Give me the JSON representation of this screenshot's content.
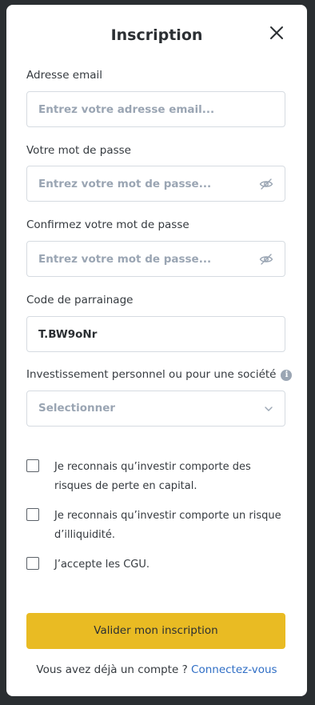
{
  "modal": {
    "title": "Inscription",
    "close_icon": "close-icon"
  },
  "email": {
    "label": "Adresse email",
    "placeholder": "Entrez votre adresse email..."
  },
  "password": {
    "label": "Votre mot de passe",
    "placeholder": "Entrez votre mot de passe...",
    "toggle_icon": "eye-off-icon"
  },
  "confirm_password": {
    "label": "Confirmez votre mot de passe",
    "placeholder": "Entrez votre mot de passe...",
    "toggle_icon": "eye-off-icon"
  },
  "referral": {
    "label": "Code de parrainage",
    "value": "T.BW9oNr"
  },
  "investment": {
    "label": "Investissement personnel ou pour une société",
    "info_icon": "info-icon",
    "selected": "Selectionner",
    "chevron_icon": "chevron-down-icon"
  },
  "checkboxes": [
    {
      "label": "Je reconnais qu’investir comporte des risques de perte en capital.",
      "checked": false
    },
    {
      "label": "Je reconnais qu’investir comporte un risque d’illiquidité.",
      "checked": false
    },
    {
      "label": "J’accepte les CGU.",
      "checked": false
    }
  ],
  "submit_label": "Valider mon inscription",
  "footer": {
    "text": "Vous avez déjà un compte ?",
    "link": "Connectez-vous"
  },
  "colors": {
    "accent": "#e9bb23",
    "link": "#2f6ec5",
    "placeholder": "#9aa5b3"
  }
}
